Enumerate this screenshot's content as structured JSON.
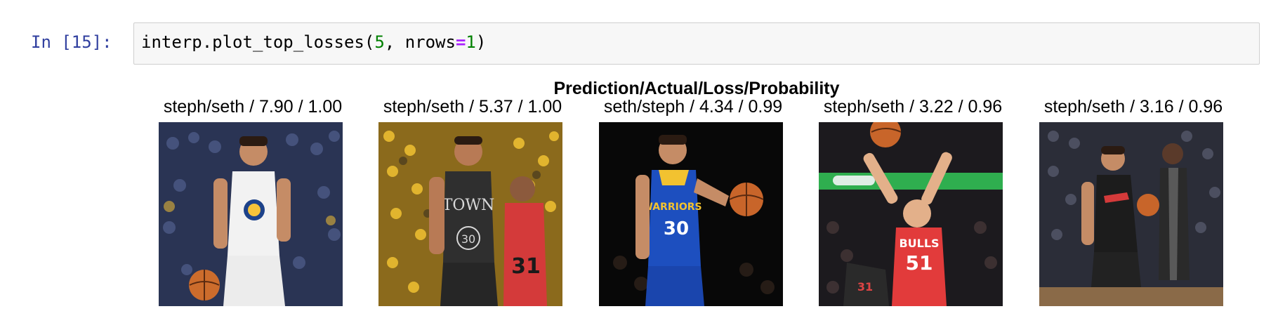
{
  "cell": {
    "prompt": "In [15]:",
    "code": {
      "func": "interp.plot_top_losses(",
      "arg1": "5",
      "sep": ", nrows",
      "eq": "=",
      "arg2": "1",
      "close": ")"
    }
  },
  "output": {
    "suptitle": "Prediction/Actual/Loss/Probability",
    "panels": [
      {
        "title": "steph/seth / 7.90 / 1.00",
        "image": "seth-warriors-white-jersey-dribbling"
      },
      {
        "title": "steph/seth / 5.37 / 1.00",
        "image": "steph-black-town-jersey-crowd-yellow"
      },
      {
        "title": "seth/steph / 4.34 / 0.99",
        "image": "steph-blue-warriors-30-dark-background"
      },
      {
        "title": "steph/seth / 3.22 / 0.96",
        "image": "bulls-51-red-jersey-rebound"
      },
      {
        "title": "steph/seth / 3.16 / 0.96",
        "image": "seth-blazers-black-jersey-dribbling"
      }
    ]
  }
}
